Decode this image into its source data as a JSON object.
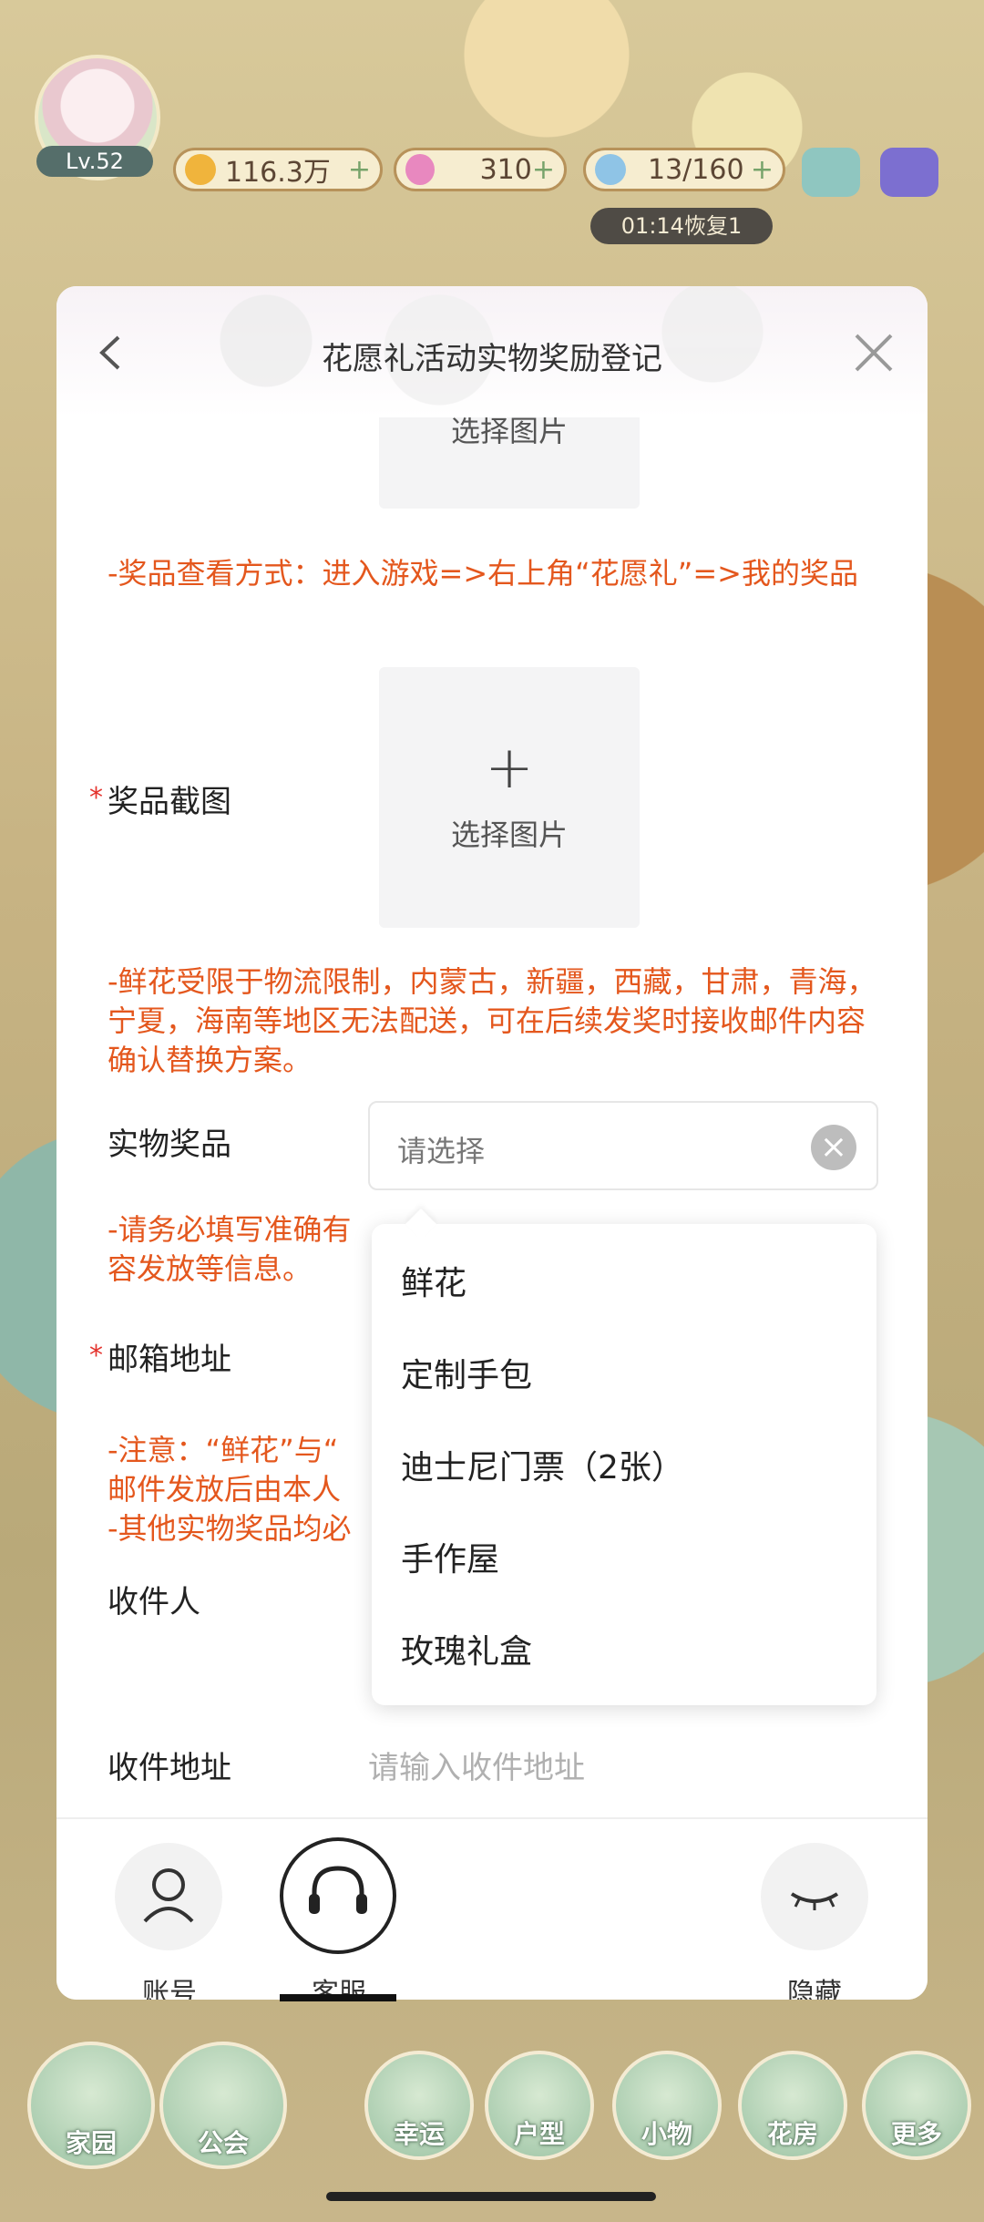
{
  "hud": {
    "level": "Lv.52",
    "coins": "116.3万",
    "stars": "310",
    "water": "13/160",
    "timer": "01:14恢复1"
  },
  "dialog": {
    "title": "花愿礼活动实物奖励登记",
    "upload_label": "选择图片",
    "note_prize_view": "-奖品查看方式：进入游戏=>右上角“花愿礼”=>我的奖品",
    "prize_screenshot_label": "奖品截图",
    "note_flower_restrict": "-鲜花受限于物流限制，内蒙古，新疆，西藏，甘肃，青海，宁夏，海南等地区无法配送，可在后续发奖时接收邮件内容确认替换方案。",
    "physical_prize_label": "实物奖品",
    "select_placeholder": "请选择",
    "note_email_line1": "-请务必填写准确有",
    "note_email_line2": "容发放等信息。",
    "email_label": "邮箱地址",
    "note_attention_1": "-注意：“鲜花”与“",
    "note_attention_2": "邮件发放后由本人",
    "note_attention_3": "-其他实物奖品均必",
    "recipient_label": "收件人",
    "address_label": "收件地址",
    "address_placeholder": "请输入收件地址"
  },
  "dropdown": {
    "options": [
      "鲜花",
      "定制手包",
      "迪士尼门票（2张）",
      "手作屋",
      "玫瑰礼盒"
    ]
  },
  "toolbar": {
    "account": "账号",
    "service": "客服",
    "hide": "隐藏"
  },
  "bottom_nav": [
    "家园",
    "公会",
    "幸运",
    "户型",
    "小物",
    "花房",
    "更多"
  ],
  "colors": {
    "note": "#e4571d",
    "required": "#e4332d"
  }
}
